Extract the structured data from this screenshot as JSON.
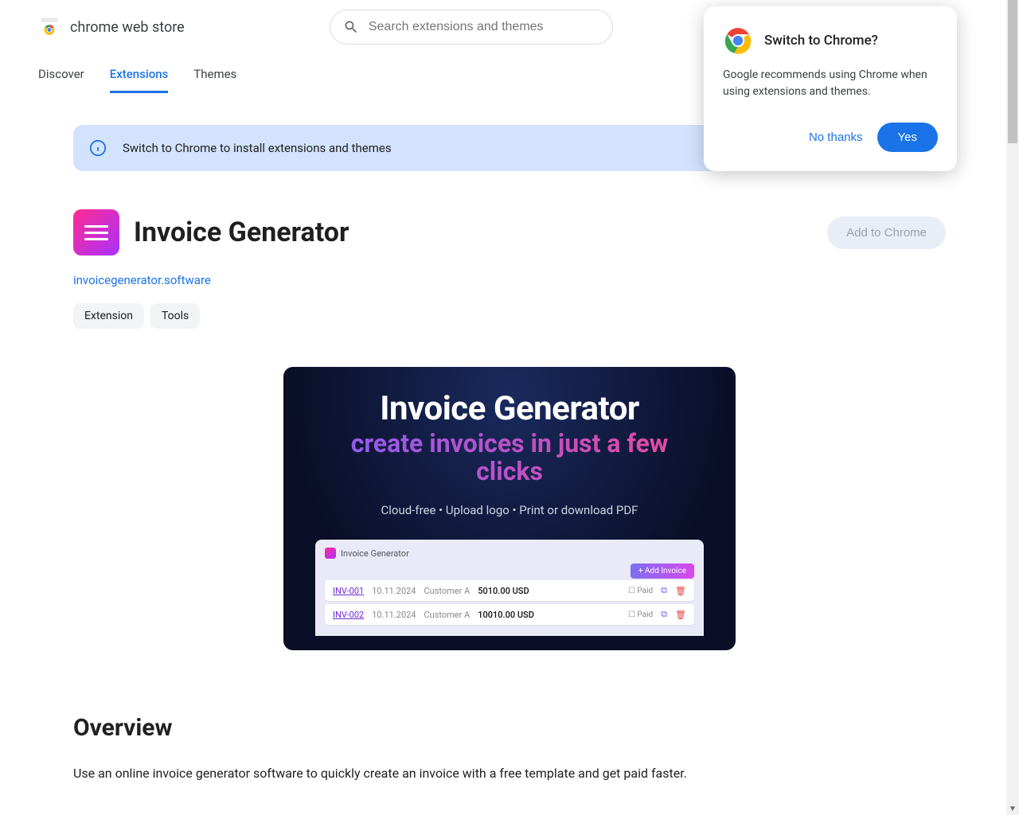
{
  "header": {
    "store_title": "chrome web store",
    "search_placeholder": "Search extensions and themes"
  },
  "nav": {
    "discover": "Discover",
    "extensions": "Extensions",
    "themes": "Themes"
  },
  "banner": {
    "text": "Switch to Chrome to install extensions and themes"
  },
  "extension": {
    "title": "Invoice Generator",
    "add_button": "Add to Chrome",
    "link": "invoicegenerator.software",
    "chip_extension": "Extension",
    "chip_tools": "Tools"
  },
  "promo": {
    "title": "Invoice Generator",
    "subtitle": "create invoices in just a few clicks",
    "features": "Cloud-free   •   Upload logo   •   Print or download PDF",
    "app_name": "Invoice Generator",
    "add_invoice": "+ Add Invoice",
    "rows": [
      {
        "inv": "INV-001",
        "date": "10.11.2024",
        "cust": "Customer A",
        "amt": "5010.00 USD",
        "paid": "Paid"
      },
      {
        "inv": "INV-002",
        "date": "10.11.2024",
        "cust": "Customer A",
        "amt": "10010.00 USD",
        "paid": "Paid"
      }
    ]
  },
  "overview": {
    "title": "Overview",
    "text": "Use an online invoice generator software to quickly create an invoice with a free template and get paid faster."
  },
  "popup": {
    "title": "Switch to Chrome?",
    "body": "Google recommends using Chrome when using extensions and themes.",
    "no_thanks": "No thanks",
    "yes": "Yes"
  }
}
